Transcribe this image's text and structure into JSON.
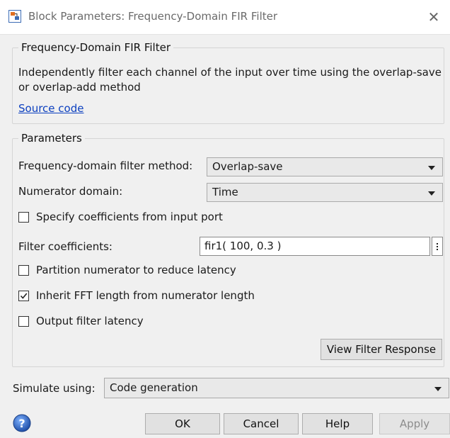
{
  "window": {
    "title": "Block Parameters: Frequency-Domain FIR Filter",
    "close_icon": "close-icon",
    "app_icon": "simulink-block-icon"
  },
  "block": {
    "legend": "Frequency-Domain FIR Filter",
    "description": "Independently filter each channel of the input over time using the overlap-save or overlap-add method",
    "source_link": "Source code"
  },
  "parameters": {
    "legend": "Parameters",
    "method_label": "Frequency-domain filter method:",
    "method_value": "Overlap-save",
    "numerator_domain_label": "Numerator domain:",
    "numerator_domain_value": "Time",
    "specify_coeffs_label": "Specify coefficients from input port",
    "specify_coeffs_checked": false,
    "filter_coeffs_label": "Filter coefficients:",
    "filter_coeffs_value": "fir1( 100, 0.3 )",
    "partition_label": "Partition numerator to reduce latency",
    "partition_checked": false,
    "inherit_fft_label": "Inherit FFT length from numerator length",
    "inherit_fft_checked": true,
    "output_latency_label": "Output filter latency",
    "output_latency_checked": false,
    "view_response_button": "View Filter Response"
  },
  "simulate": {
    "label": "Simulate using:",
    "value": "Code generation"
  },
  "footer": {
    "ok": "OK",
    "cancel": "Cancel",
    "help": "Help",
    "apply": "Apply",
    "help_icon": "help-icon"
  },
  "colors": {
    "link": "#0b3fbf",
    "help_icon_blue": "#2e6ac9"
  }
}
